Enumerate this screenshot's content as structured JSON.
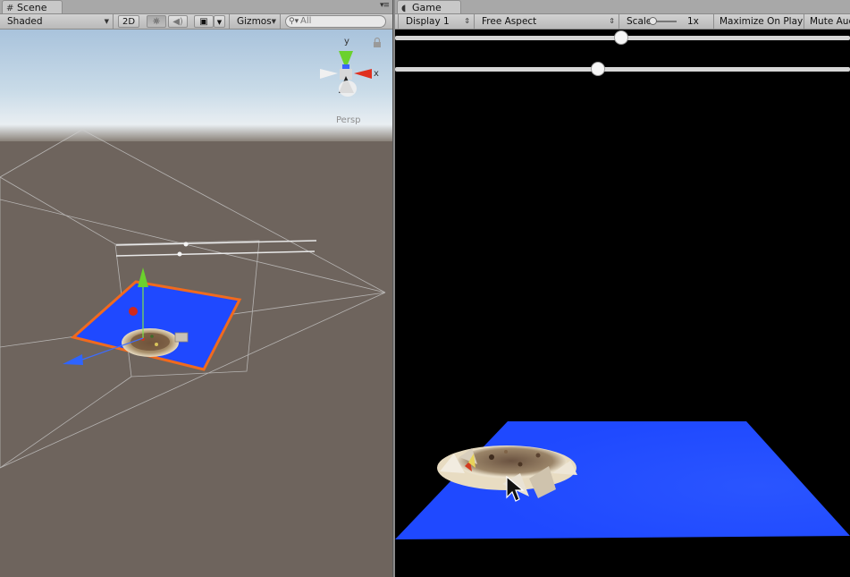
{
  "scene": {
    "tab_label": "Scene",
    "shading_mode": "Shaded",
    "btn_2d": "2D",
    "gizmos_label": "Gizmos",
    "search_placeholder": "All",
    "projection_label": "Persp",
    "gizmo_axis_y": "y",
    "gizmo_axis_x": "x"
  },
  "game": {
    "tab_label": "Game",
    "display": "Display 1",
    "aspect": "Free Aspect",
    "scale_label": "Scale",
    "scale_value": "1x",
    "maximize_label": "Maximize On Play",
    "mute_label": "Mute Audio",
    "slider1_value": 0.5,
    "slider2_value": 0.45
  },
  "colors": {
    "plane_blue": "#1f49ff",
    "selection_orange": "#f06a1e",
    "sky_top": "#a9c3dc",
    "ground": "#6e645d"
  }
}
